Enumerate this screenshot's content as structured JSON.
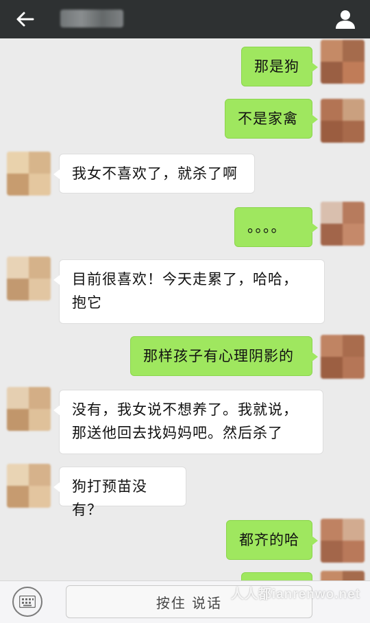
{
  "header": {
    "back_icon": "arrow-left-icon",
    "profile_icon": "user-icon",
    "bar_color": "#2e3132"
  },
  "messages": [
    {
      "side": "out",
      "text": "那是狗"
    },
    {
      "side": "out",
      "text": "不是家禽"
    },
    {
      "side": "in",
      "text": "我女不喜欢了，就杀了啊"
    },
    {
      "side": "out",
      "text": "。。。。"
    },
    {
      "side": "in",
      "text": "目前很喜欢！今天走累了，哈哈，抱它"
    },
    {
      "side": "out",
      "text": "那样孩子有心理阴影的"
    },
    {
      "side": "in",
      "text": "没有，我女说不想养了。我就说，那送他回去找妈妈吧。然后杀了"
    },
    {
      "side": "in",
      "text": "狗打预苗没有？"
    },
    {
      "side": "out",
      "text": "都齐的哈"
    }
  ],
  "input_bar": {
    "keyboard_icon": "keyboard-icon",
    "hold_to_talk": "按住 说话"
  },
  "watermark": "人人都ianrenwo.net",
  "colors": {
    "outgoing_bubble": "#9fe75f",
    "incoming_bubble": "#ffffff",
    "chat_background": "#ebebeb"
  }
}
